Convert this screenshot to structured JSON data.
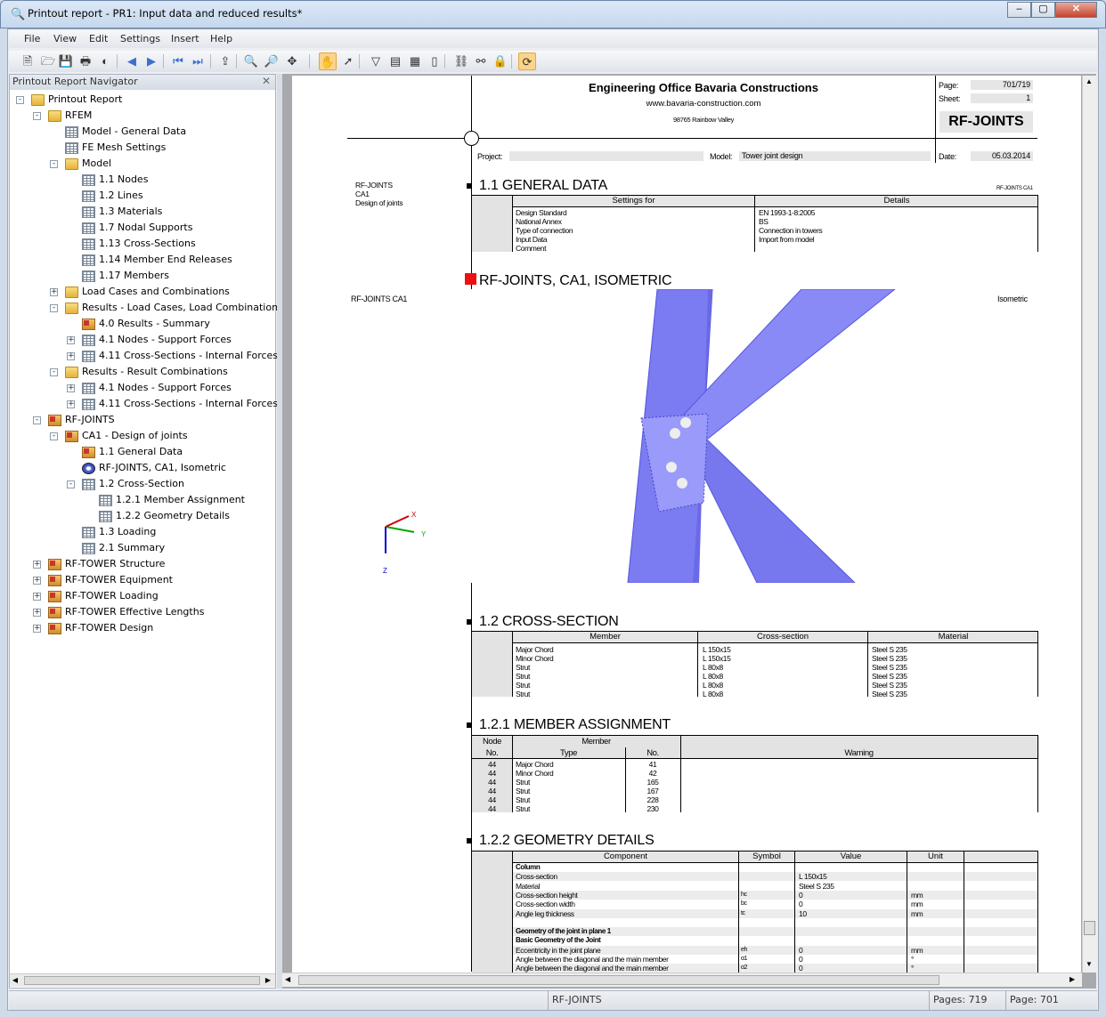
{
  "window": {
    "title": "Printout report - PR1: Input data and reduced results*",
    "controls": [
      "minimize",
      "maximize",
      "close"
    ]
  },
  "menu": [
    "File",
    "View",
    "Edit",
    "Settings",
    "Insert",
    "Help"
  ],
  "toolbar": [
    {
      "icon": "new-report-icon"
    },
    {
      "icon": "open-icon"
    },
    {
      "icon": "save-icon"
    },
    {
      "icon": "print-icon"
    },
    {
      "icon": "color-icon"
    },
    {
      "icon": "previous-page-icon"
    },
    {
      "icon": "next-page-icon"
    },
    {
      "icon": "first-page-icon"
    },
    {
      "icon": "last-page-icon"
    },
    {
      "icon": "export-icon"
    },
    {
      "icon": "zoom-in-icon"
    },
    {
      "icon": "zoom-out-icon"
    },
    {
      "icon": "zoom-options-icon"
    },
    {
      "icon": "pan-hand-icon",
      "active": true
    },
    {
      "icon": "select-pointer-icon"
    },
    {
      "icon": "filter-page-icon"
    },
    {
      "icon": "page-header-icon"
    },
    {
      "icon": "page-layout-icon"
    },
    {
      "icon": "blank-page-icon"
    },
    {
      "icon": "link-icon"
    },
    {
      "icon": "unlink-icon"
    },
    {
      "icon": "lock-icon"
    },
    {
      "icon": "refresh-icon",
      "active": true
    }
  ],
  "navigator": {
    "title": "Printout Report Navigator",
    "items": [
      {
        "label": "Printout Report",
        "level": 0,
        "icon": "folder",
        "exp": "-"
      },
      {
        "label": "RFEM",
        "level": 1,
        "icon": "folder",
        "exp": "-"
      },
      {
        "label": "Model - General Data",
        "level": 2,
        "icon": "table"
      },
      {
        "label": "FE Mesh Settings",
        "level": 2,
        "icon": "table"
      },
      {
        "label": "Model",
        "level": 2,
        "icon": "folder",
        "exp": "-"
      },
      {
        "label": "1.1 Nodes",
        "level": 3,
        "icon": "table"
      },
      {
        "label": "1.2 Lines",
        "level": 3,
        "icon": "table"
      },
      {
        "label": "1.3 Materials",
        "level": 3,
        "icon": "table"
      },
      {
        "label": "1.7 Nodal Supports",
        "level": 3,
        "icon": "table"
      },
      {
        "label": "1.13 Cross-Sections",
        "level": 3,
        "icon": "table"
      },
      {
        "label": "1.14 Member End Releases",
        "level": 3,
        "icon": "table"
      },
      {
        "label": "1.17 Members",
        "level": 3,
        "icon": "table"
      },
      {
        "label": "Load Cases and Combinations",
        "level": 2,
        "icon": "folder",
        "exp": "+"
      },
      {
        "label": "Results - Load Cases, Load Combinations",
        "level": 2,
        "icon": "folder",
        "exp": "-"
      },
      {
        "label": "4.0 Results - Summary",
        "level": 3,
        "icon": "module"
      },
      {
        "label": "4.1 Nodes - Support Forces",
        "level": 3,
        "icon": "table",
        "exp": "+"
      },
      {
        "label": "4.11 Cross-Sections - Internal Forces",
        "level": 3,
        "icon": "table",
        "exp": "+"
      },
      {
        "label": "Results - Result Combinations",
        "level": 2,
        "icon": "folder",
        "exp": "-"
      },
      {
        "label": "4.1 Nodes - Support Forces",
        "level": 3,
        "icon": "table",
        "exp": "+"
      },
      {
        "label": "4.11 Cross-Sections - Internal Forces",
        "level": 3,
        "icon": "table",
        "exp": "+"
      },
      {
        "label": "RF-JOINTS",
        "level": 1,
        "icon": "module",
        "exp": "-"
      },
      {
        "label": "CA1 - Design of joints",
        "level": 2,
        "icon": "module",
        "exp": "-"
      },
      {
        "label": "1.1 General Data",
        "level": 3,
        "icon": "module"
      },
      {
        "label": "RF-JOINTS, CA1, Isometric",
        "level": 3,
        "icon": "graphic"
      },
      {
        "label": "1.2 Cross-Section",
        "level": 3,
        "icon": "table",
        "exp": "-"
      },
      {
        "label": "1.2.1 Member Assignment",
        "level": 4,
        "icon": "table"
      },
      {
        "label": "1.2.2 Geometry Details",
        "level": 4,
        "icon": "table"
      },
      {
        "label": "1.3 Loading",
        "level": 3,
        "icon": "table"
      },
      {
        "label": "2.1 Summary",
        "level": 3,
        "icon": "table"
      },
      {
        "label": "RF-TOWER Structure",
        "level": 1,
        "icon": "module",
        "exp": "+"
      },
      {
        "label": "RF-TOWER Equipment",
        "level": 1,
        "icon": "module",
        "exp": "+"
      },
      {
        "label": "RF-TOWER Loading",
        "level": 1,
        "icon": "module",
        "exp": "+"
      },
      {
        "label": "RF-TOWER Effective Lengths",
        "level": 1,
        "icon": "module",
        "exp": "+"
      },
      {
        "label": "RF-TOWER Design",
        "level": 1,
        "icon": "module",
        "exp": "+"
      }
    ]
  },
  "page": {
    "company": "Engineering Office Bavaria Constructions",
    "website": "www.bavaria-construction.com",
    "address": "98765 Rainbow Valley",
    "page_label": "Page:",
    "page_value": "701/719",
    "sheet_label": "Sheet:",
    "sheet_value": "1",
    "module": "RF-JOINTS",
    "project_label": "Project:",
    "project_value": "",
    "model_label": "Model:",
    "model_value": "Tower joint design",
    "date_label": "Date:",
    "date_value": "05.03.2014",
    "side_note": [
      "RF-JOINTS",
      "CA1",
      "Design of joints"
    ],
    "general": {
      "title": "1.1 GENERAL DATA",
      "tag": "RF-JOINTS CA1",
      "headers": [
        "Settings for",
        "Details"
      ],
      "rows": [
        [
          "Design Standard",
          "EN 1993-1-8:2005"
        ],
        [
          "National Annex",
          "BS"
        ],
        [
          "Type of connection",
          "Connection in towers"
        ],
        [
          "Input Data",
          "Import from model"
        ],
        [
          "Comment",
          ""
        ]
      ]
    },
    "graphic": {
      "title": "RF-JOINTS, CA1, ISOMETRIC",
      "left_label": "RF-JOINTS CA1",
      "right_label": "Isometric",
      "axes": [
        "X",
        "Y",
        "Z"
      ],
      "marker_color": "#ee1111",
      "model_color": "#7b7bf2"
    },
    "cross_section": {
      "title": "1.2 CROSS-SECTION",
      "headers": [
        "Member",
        "Cross-section",
        "Material"
      ],
      "rows": [
        [
          "Major Chord",
          "L 150x15",
          "Steel S 235"
        ],
        [
          "Minor Chord",
          "L 150x15",
          "Steel S 235"
        ],
        [
          "Strut",
          "L 80x8",
          "Steel S 235"
        ],
        [
          "Strut",
          "L 80x8",
          "Steel S 235"
        ],
        [
          "Strut",
          "L 80x8",
          "Steel S 235"
        ],
        [
          "Strut",
          "L 80x8",
          "Steel S 235"
        ]
      ]
    },
    "member_assignment": {
      "title": "1.2.1 MEMBER ASSIGNMENT",
      "headers": {
        "node": "Node",
        "node_no": "No.",
        "member": "Member",
        "type": "Type",
        "no": "No.",
        "warning": "Warning"
      },
      "rows": [
        [
          "44",
          "Major Chord",
          "41"
        ],
        [
          "44",
          "Minor Chord",
          "42"
        ],
        [
          "44",
          "Strut",
          "165"
        ],
        [
          "44",
          "Strut",
          "167"
        ],
        [
          "44",
          "Strut",
          "228"
        ],
        [
          "44",
          "Strut",
          "230"
        ]
      ]
    },
    "geometry": {
      "title": "1.2.2 GEOMETRY DETAILS",
      "headers": [
        "Component",
        "Symbol",
        "Value",
        "Unit"
      ],
      "rows": [
        {
          "c": "Column",
          "s": "",
          "v": "",
          "u": "",
          "bold": true
        },
        {
          "c": "Cross-section",
          "s": "",
          "v": "L 150x15",
          "u": ""
        },
        {
          "c": "Material",
          "s": "",
          "v": "Steel S 235",
          "u": ""
        },
        {
          "c": "Cross-section height",
          "s": "hc",
          "v": "0",
          "u": "mm"
        },
        {
          "c": "Cross-section width",
          "s": "bc",
          "v": "0",
          "u": "mm"
        },
        {
          "c": "Angle leg thickness",
          "s": "tc",
          "v": "10",
          "u": "mm"
        },
        {
          "c": "",
          "s": "",
          "v": "",
          "u": ""
        },
        {
          "c": "Geometry of the joint in plane 1",
          "s": "",
          "v": "",
          "u": "",
          "bold": true
        },
        {
          "c": "Basic Geometry of the Joint",
          "s": "",
          "v": "",
          "u": "",
          "bold": true
        },
        {
          "c": "Eccentricity in the joint plane",
          "s": "eh",
          "v": "0",
          "u": "mm"
        },
        {
          "c": "Angle between the diagonal and the main member",
          "s": "α1",
          "v": "0",
          "u": "°"
        },
        {
          "c": "Angle between the diagonal and the main member",
          "s": "α2",
          "v": "0",
          "u": "°"
        }
      ]
    }
  },
  "status": {
    "module": "RF-JOINTS",
    "pages": "Pages: 719",
    "page": "Page: 701"
  }
}
